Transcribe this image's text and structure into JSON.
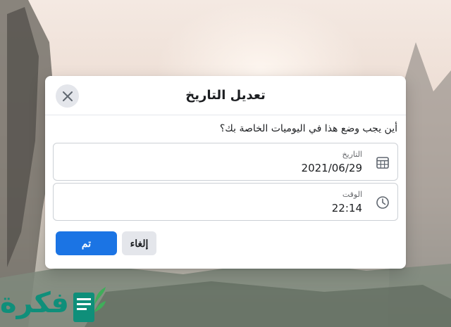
{
  "dialog": {
    "title": "تعديل التاريخ",
    "question": "أين يجب وضع هذا في اليوميات الخاصة بك؟",
    "date_field": {
      "label": "التاريخ",
      "value": "2021/06/29",
      "icon": "calendar-icon"
    },
    "time_field": {
      "label": "الوقت",
      "value": "22:14",
      "icon": "clock-icon"
    },
    "cancel_label": "إلغاء",
    "done_label": "تم",
    "close_icon": "close-icon"
  },
  "watermark": {
    "text": "فكرة",
    "icon": "book-leaf-icon"
  },
  "colors": {
    "primary_button": "#1b74e4",
    "secondary_button": "#e4e6eb",
    "logo": "#0f8f7a"
  }
}
